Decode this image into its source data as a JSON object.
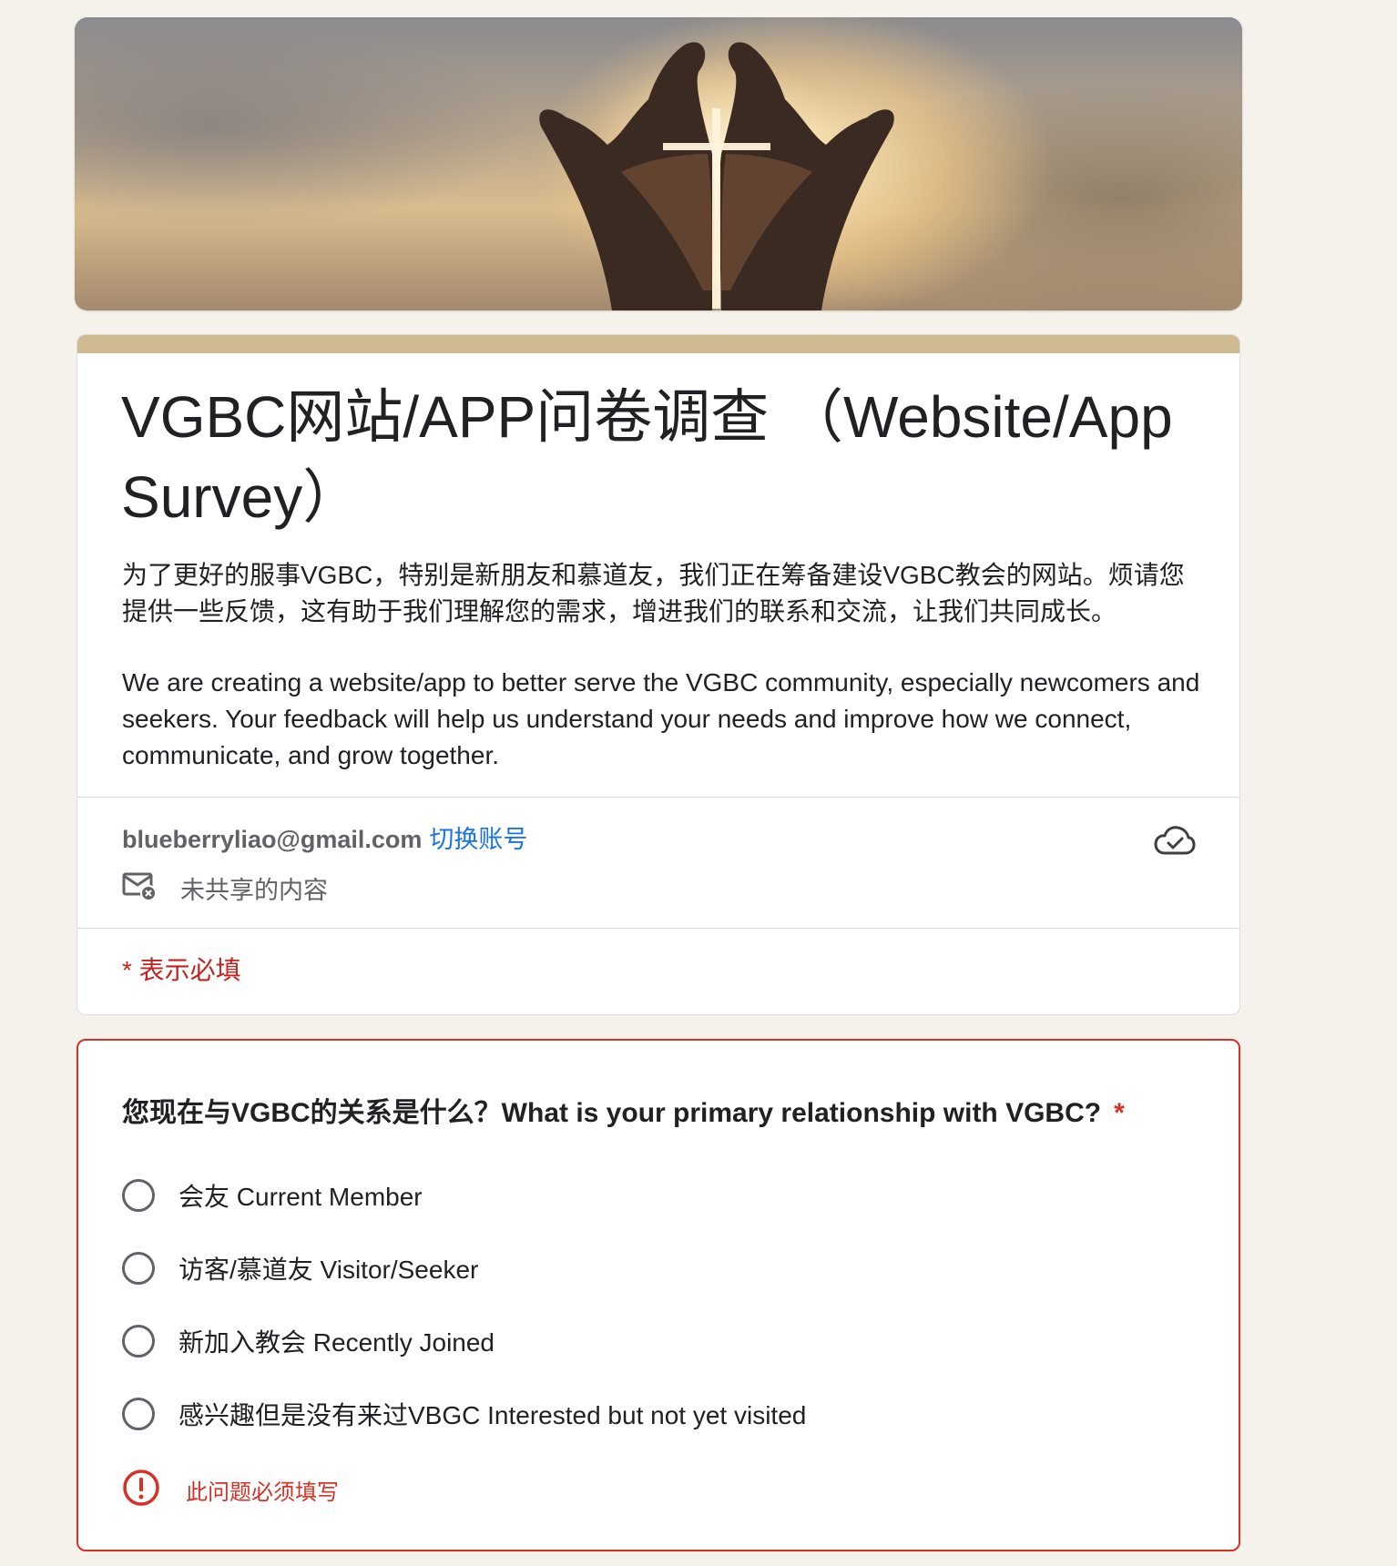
{
  "header": {
    "title": "VGBC网站/APP问卷调查 （Website/App Survey）",
    "description_cn": "为了更好的服事VGBC，特别是新朋友和慕道友，我们正在筹备建设VGBC教会的网站。烦请您提供一些反馈，这有助于我们理解您的需求，增进我们的联系和交流，让我们共同成长。",
    "description_en": "We are creating a website/app to better serve the VGBC community, especially newcomers and seekers. Your feedback will help us understand your needs and improve how we connect, communicate, and grow together.",
    "account_email": "blueberryliao@gmail.com",
    "switch_account": "切换账号",
    "share_status": "未共享的内容",
    "required_note": "* 表示必填"
  },
  "question": {
    "title": "您现在与VGBC的关系是什么？What is your primary relationship with VGBC?",
    "required_marker": "*",
    "options": [
      {
        "label": "会友 Current Member"
      },
      {
        "label": "访客/慕道友 Visitor/Seeker"
      },
      {
        "label": "新加入教会 Recently Joined"
      },
      {
        "label": "感兴趣但是没有来过VBGC Interested but not yet visited"
      }
    ],
    "error": "此问题必须填写"
  },
  "colors": {
    "accent": "#cfba92",
    "link": "#1a73e8",
    "error": "#d93025",
    "background": "#f5f1eb"
  },
  "icons": {
    "banner": "praying-hands-cross-image",
    "cloud": "cloud-check-icon",
    "mail": "mail-x-icon",
    "error": "exclamation-circle-icon"
  }
}
